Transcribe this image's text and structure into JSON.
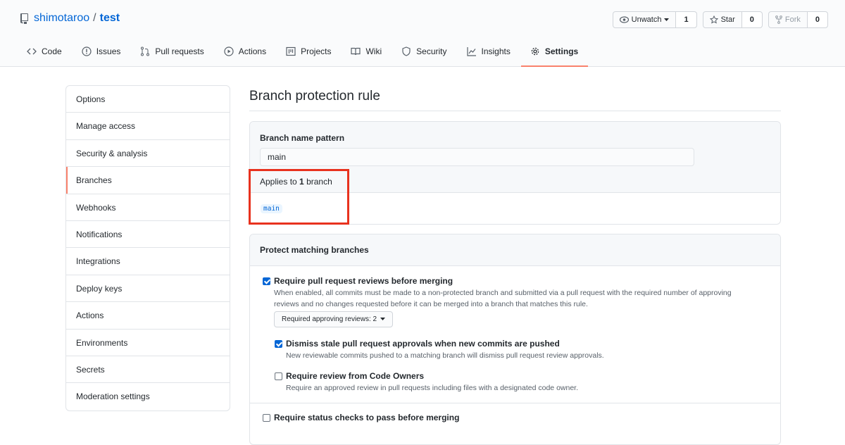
{
  "repo": {
    "owner": "shimotaroo",
    "separator": "/",
    "name": "test"
  },
  "actions": {
    "watch": {
      "label": "Unwatch",
      "count": "1"
    },
    "star": {
      "label": "Star",
      "count": "0"
    },
    "fork": {
      "label": "Fork",
      "count": "0"
    }
  },
  "tabs": [
    {
      "label": "Code",
      "icon": "code-icon"
    },
    {
      "label": "Issues",
      "icon": "issue-icon"
    },
    {
      "label": "Pull requests",
      "icon": "pull-request-icon"
    },
    {
      "label": "Actions",
      "icon": "play-icon"
    },
    {
      "label": "Projects",
      "icon": "project-icon"
    },
    {
      "label": "Wiki",
      "icon": "book-icon"
    },
    {
      "label": "Security",
      "icon": "shield-icon"
    },
    {
      "label": "Insights",
      "icon": "graph-icon"
    },
    {
      "label": "Settings",
      "icon": "gear-icon",
      "selected": true
    }
  ],
  "sidebar": {
    "items": [
      {
        "label": "Options"
      },
      {
        "label": "Manage access"
      },
      {
        "label": "Security & analysis"
      },
      {
        "label": "Branches",
        "selected": true
      },
      {
        "label": "Webhooks"
      },
      {
        "label": "Notifications"
      },
      {
        "label": "Integrations"
      },
      {
        "label": "Deploy keys"
      },
      {
        "label": "Actions"
      },
      {
        "label": "Environments"
      },
      {
        "label": "Secrets"
      },
      {
        "label": "Moderation settings"
      }
    ]
  },
  "main": {
    "title": "Branch protection rule",
    "pattern": {
      "label": "Branch name pattern",
      "value": "main",
      "applies_prefix": "Applies to ",
      "applies_count": "1",
      "applies_suffix": " branch",
      "branches": [
        "main"
      ]
    },
    "protect": {
      "heading": "Protect matching branches",
      "rules": [
        {
          "title": "Require pull request reviews before merging",
          "checked": true,
          "description": "When enabled, all commits must be made to a non-protected branch and submitted via a pull request with the required number of approving reviews and no changes requested before it can be merged into a branch that matches this rule.",
          "select": "Required approving reviews: 2"
        },
        {
          "title": "Dismiss stale pull request approvals when new commits are pushed",
          "checked": true,
          "description": "New reviewable commits pushed to a matching branch will dismiss pull request review approvals."
        },
        {
          "title": "Require review from Code Owners",
          "checked": false,
          "description": "Require an approved review in pull requests including files with a designated code owner."
        },
        {
          "title": "Require status checks to pass before merging",
          "checked": false
        }
      ]
    }
  },
  "colors": {
    "link": "#0366d6",
    "accent": "#f9826c",
    "highlight": "#e8321e"
  }
}
